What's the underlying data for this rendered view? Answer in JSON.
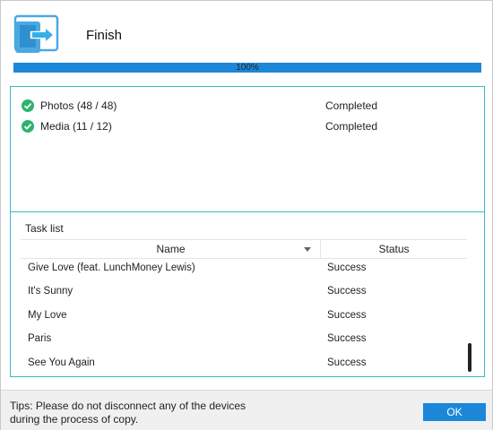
{
  "window": {
    "title": "Finish",
    "icon": "device-transfer-icon",
    "accent_color": "#1c87d9",
    "border_color": "#39b8c6"
  },
  "progress": {
    "value_percent": 100,
    "label": "100%"
  },
  "summary": [
    {
      "label": "Photos (48 / 48)",
      "status": "Completed",
      "icon": "check-circle-icon",
      "color": "#2db36b"
    },
    {
      "label": "Media (11 / 12)",
      "status": "Completed",
      "icon": "check-circle-icon",
      "color": "#2db36b"
    }
  ],
  "task_list": {
    "label": "Task list",
    "columns": [
      "Name",
      "Status"
    ],
    "rows": [
      {
        "name": "Give Love (feat. LunchMoney Lewis)",
        "status": "Success"
      },
      {
        "name": "It's Sunny",
        "status": "Success"
      },
      {
        "name": "My Love",
        "status": "Success"
      },
      {
        "name": "Paris",
        "status": "Success"
      },
      {
        "name": "See You Again",
        "status": "Success"
      }
    ]
  },
  "footer": {
    "tips_line1": "Tips: Please do not disconnect any of the devices",
    "tips_line2": "during the process of copy.",
    "ok_label": "OK"
  }
}
